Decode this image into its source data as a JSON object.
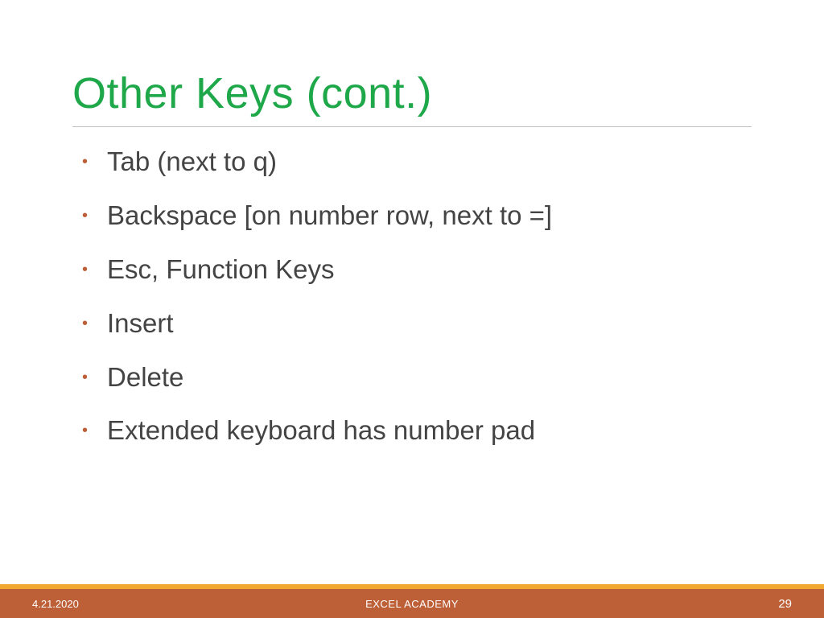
{
  "slide": {
    "title": "Other Keys (cont.)",
    "bullets": [
      "Tab (next to q)",
      "Backspace [on number row, next to =]",
      "Esc, Function Keys",
      "Insert",
      "Delete",
      "Extended keyboard has number pad"
    ]
  },
  "footer": {
    "date": "4.21.2020",
    "center": "EXCEL ACADEMY",
    "page": "29"
  }
}
